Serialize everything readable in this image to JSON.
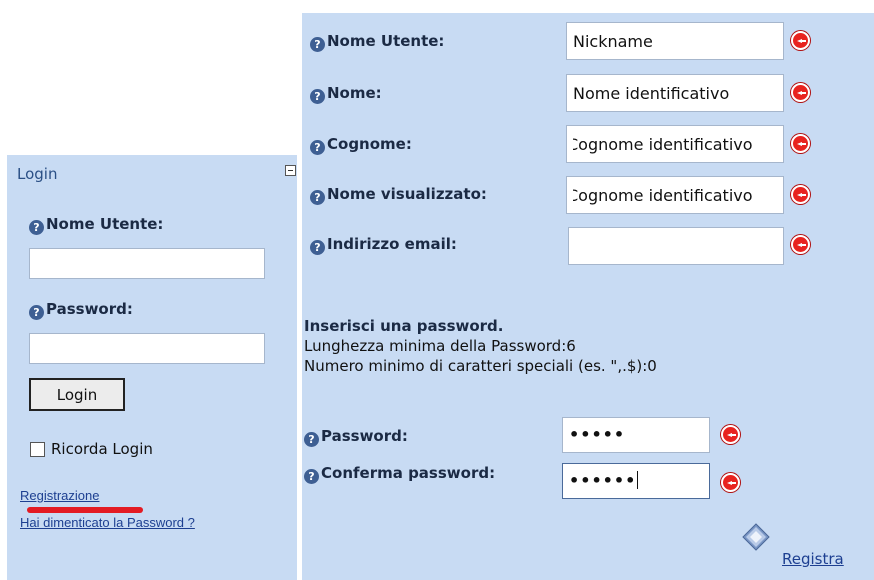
{
  "login": {
    "title": "Login",
    "username_label": "Nome Utente:",
    "username_value": "",
    "password_label": "Password:",
    "password_value": "",
    "login_button": "Login",
    "remember_label": "Ricorda Login",
    "register_link": "Registrazione",
    "forgot_link": "Hai dimenticato la Password ?"
  },
  "registration": {
    "fields": [
      {
        "label": "Nome Utente:",
        "value": "Nickname"
      },
      {
        "label": "Nome:",
        "value": "Nome identificativo"
      },
      {
        "label": "Cognome:",
        "value": "Cognome identificativo"
      },
      {
        "label": "Nome visualizzato:",
        "value": "Cognome identificativo"
      },
      {
        "label": "Indirizzo email:",
        "value": ""
      }
    ],
    "password_heading": "Inserisci una password.",
    "min_length": "Lunghezza minima della Password:6",
    "min_special": "Numero minimo di caratteri speciali (es. \",.$):0",
    "password_label": "Password:",
    "password_mask": "•••••",
    "confirm_label": "Conferma password:",
    "confirm_mask": "••••••",
    "submit_link": "Registra"
  },
  "icons": {
    "help": "help-question-icon",
    "required": "required-arrow-icon",
    "register": "register-diamond-icon"
  },
  "colors": {
    "panel_bg": "#c8dbf3",
    "title": "#2a4f85",
    "link": "#1d3f91",
    "required": "#e8231f"
  }
}
